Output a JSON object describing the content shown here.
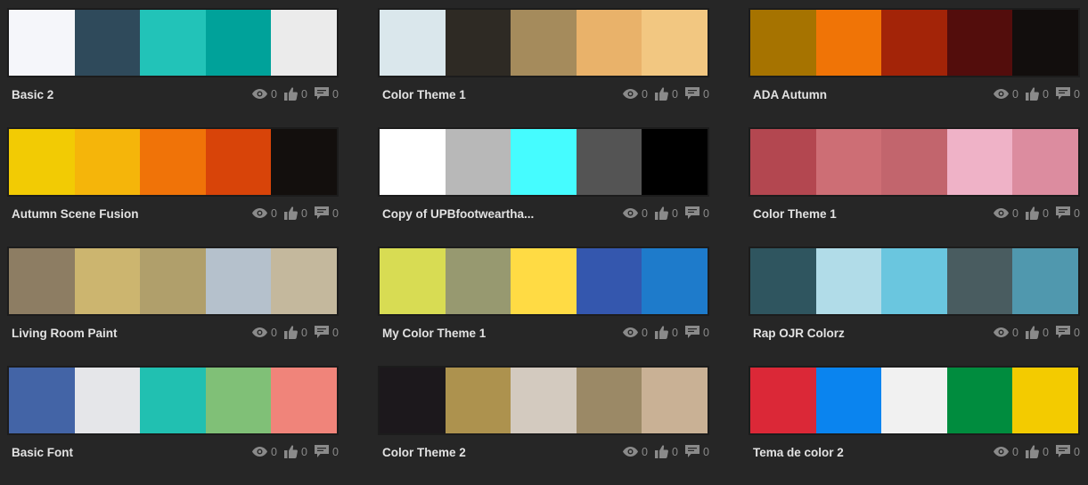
{
  "themes": [
    {
      "name": "Basic 2",
      "colors": [
        "#f5f6fa",
        "#2f4a5b",
        "#22c3b8",
        "#00a29a",
        "#ebebeb"
      ],
      "views": "0",
      "likes": "0",
      "comments": "0"
    },
    {
      "name": "Color Theme 1",
      "colors": [
        "#dae7ec",
        "#2e2a24",
        "#a58b5c",
        "#e9b26a",
        "#f2c781"
      ],
      "views": "0",
      "likes": "0",
      "comments": "0"
    },
    {
      "name": "ADA Autumn",
      "colors": [
        "#a67300",
        "#f07406",
        "#a32408",
        "#530d0c",
        "#120e0d"
      ],
      "views": "0",
      "likes": "0",
      "comments": "0"
    },
    {
      "name": "Autumn Scene Fusion",
      "colors": [
        "#f2cb04",
        "#f5b50a",
        "#f07308",
        "#d84409",
        "#130f0d"
      ],
      "views": "0",
      "likes": "0",
      "comments": "0"
    },
    {
      "name": "Copy of UPBfootwearthа...",
      "colors": [
        "#ffffff",
        "#b8b8b8",
        "#45fcff",
        "#545454",
        "#000000"
      ],
      "views": "0",
      "likes": "0",
      "comments": "0"
    },
    {
      "name": "Color Theme 1",
      "colors": [
        "#b34750",
        "#cd6e75",
        "#c2656d",
        "#efb2c7",
        "#dc8c9f"
      ],
      "views": "0",
      "likes": "0",
      "comments": "0"
    },
    {
      "name": "Living Room Paint",
      "colors": [
        "#8d7d63",
        "#ccb56f",
        "#b09f6b",
        "#b5c1cc",
        "#c4b89d"
      ],
      "views": "0",
      "likes": "0",
      "comments": "0"
    },
    {
      "name": "My Color Theme 1",
      "colors": [
        "#d8dc53",
        "#979970",
        "#ffdb44",
        "#3457ae",
        "#1e7bcb"
      ],
      "views": "0",
      "likes": "0",
      "comments": "0"
    },
    {
      "name": "Rap OJR Colorz",
      "colors": [
        "#2f555f",
        "#b1dce8",
        "#6ac6df",
        "#495c60",
        "#5098ae"
      ],
      "views": "0",
      "likes": "0",
      "comments": "0"
    },
    {
      "name": "Basic Font",
      "colors": [
        "#4364a6",
        "#e5e6e9",
        "#21c0b1",
        "#80c077",
        "#f0847a"
      ],
      "views": "0",
      "likes": "0",
      "comments": "0"
    },
    {
      "name": "Color Theme 2",
      "colors": [
        "#1c181c",
        "#ad924e",
        "#d3cabf",
        "#9b8966",
        "#c9b195"
      ],
      "views": "0",
      "likes": "0",
      "comments": "0"
    },
    {
      "name": "Tema de color 2",
      "colors": [
        "#db2837",
        "#0a84ef",
        "#f1f1f1",
        "#008c3e",
        "#f3cb00"
      ],
      "views": "0",
      "likes": "0",
      "comments": "0"
    }
  ],
  "icons": {
    "views": "eye-icon",
    "likes": "thumbs-up-icon",
    "comments": "comment-icon"
  }
}
